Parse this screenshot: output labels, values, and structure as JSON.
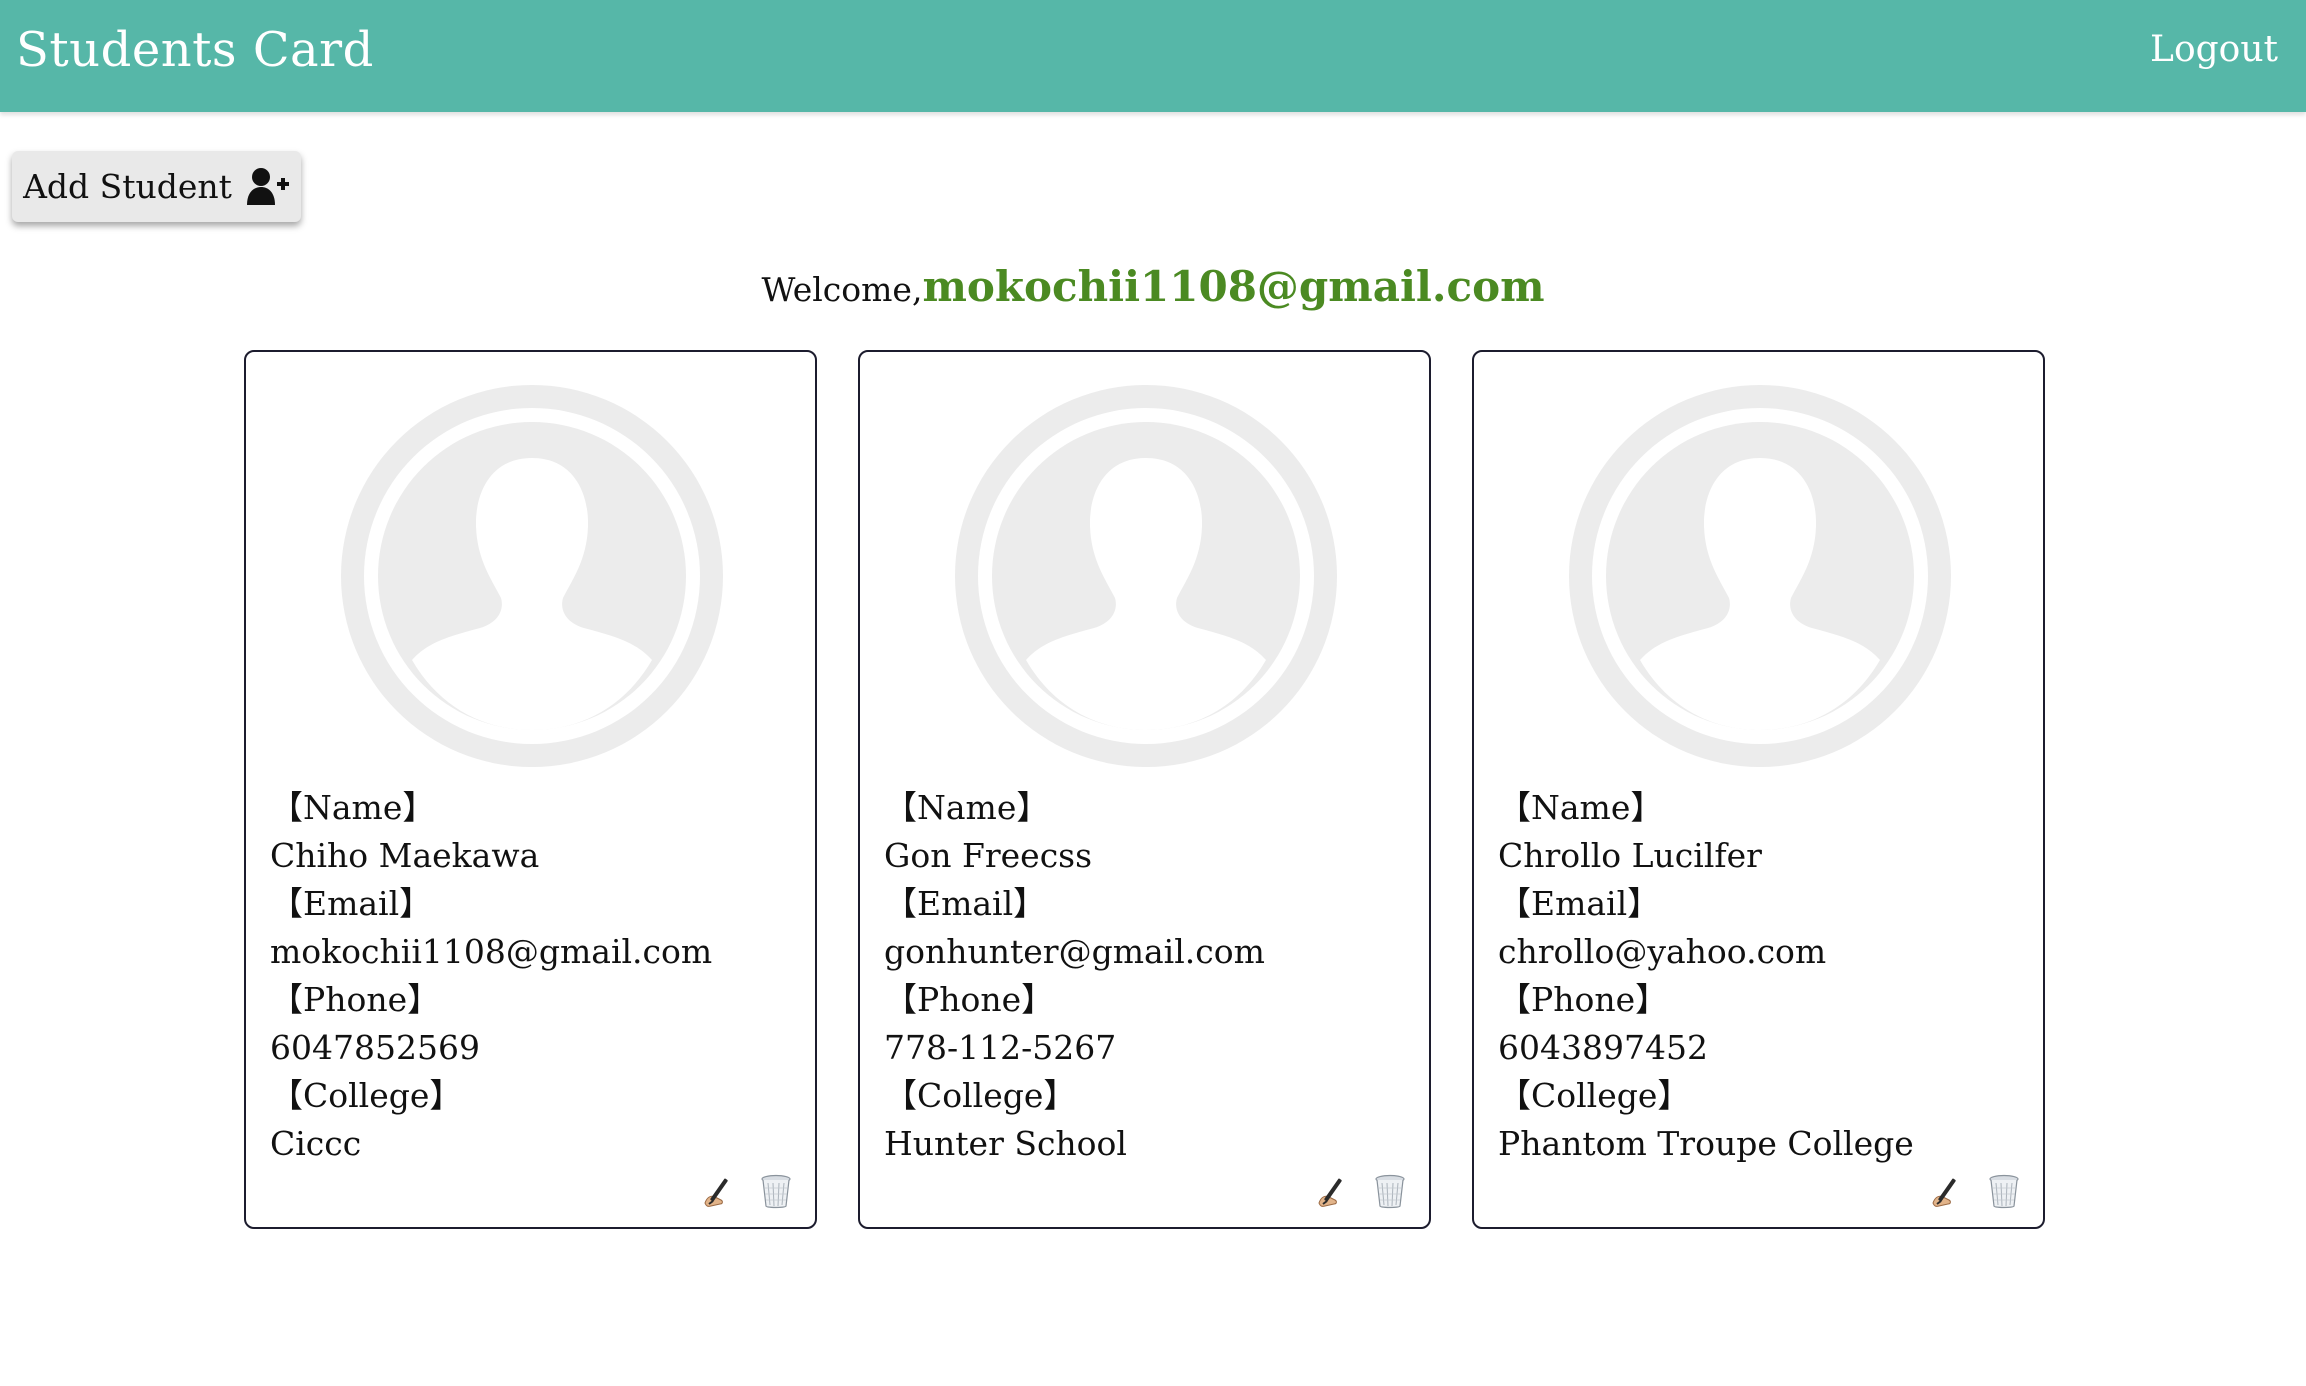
{
  "header": {
    "title": "Students Card",
    "logout_label": "Logout"
  },
  "toolbar": {
    "add_label": "Add Student",
    "add_icon": "user-plus-icon"
  },
  "welcome": {
    "label": "Welcome,",
    "email": "mokochii1108@gmail.com"
  },
  "labels": {
    "name": "【Name】",
    "email": "【Email】",
    "phone": "【Phone】",
    "college": "【College】"
  },
  "students": [
    {
      "name": "Chiho Maekawa",
      "email": "mokochii1108@gmail.com",
      "phone": "6047852569",
      "college": "Ciccc"
    },
    {
      "name": "Gon Freecss",
      "email": "gonhunter@gmail.com",
      "phone": "778-112-5267",
      "college": "Hunter School"
    },
    {
      "name": "Chrollo Lucilfer",
      "email": "chrollo@yahoo.com",
      "phone": "6043897452",
      "college": "Phantom Troupe College"
    }
  ],
  "colors": {
    "header_bg": "#56b7a8",
    "welcome_email": "#4b8a22"
  }
}
